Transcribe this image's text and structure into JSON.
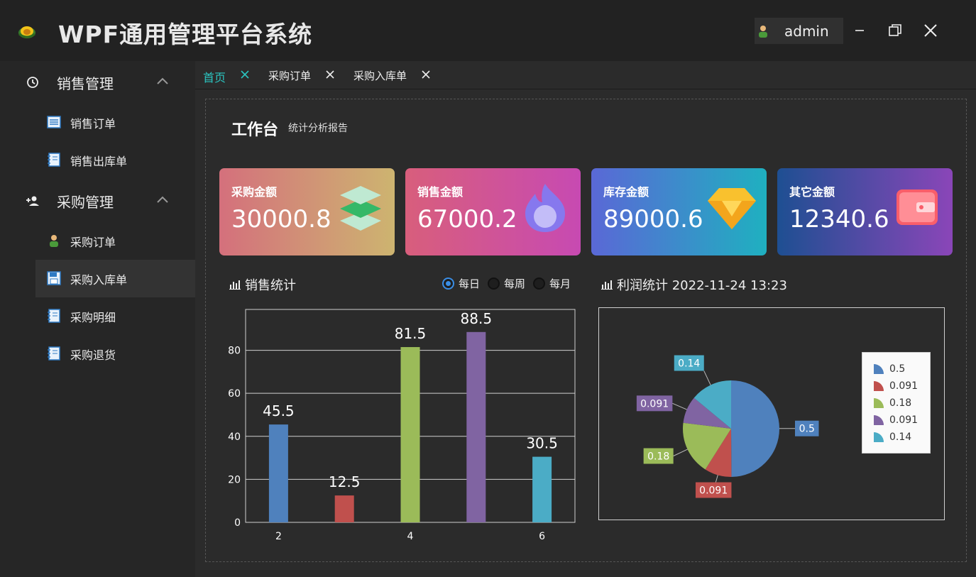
{
  "app": {
    "title": "WPF通用管理平台系统",
    "user": "admin"
  },
  "sidebar": {
    "groups": [
      {
        "label": "销售管理",
        "icon": "clock-icon",
        "items": [
          {
            "label": "销售订单",
            "icon": "list-icon"
          },
          {
            "label": "销售出库单",
            "icon": "notebook-icon"
          }
        ]
      },
      {
        "label": "采购管理",
        "icon": "person-add-icon",
        "items": [
          {
            "label": "采购订单",
            "icon": "user-icon"
          },
          {
            "label": "采购入库单",
            "icon": "save-icon",
            "active": true
          },
          {
            "label": "采购明细",
            "icon": "notebook-icon"
          },
          {
            "label": "采购退货",
            "icon": "notebook-icon"
          }
        ]
      }
    ]
  },
  "tabs": [
    {
      "label": "首页",
      "active": true
    },
    {
      "label": "采购订单"
    },
    {
      "label": "采购入库单"
    }
  ],
  "dashboard": {
    "title": "工作台",
    "subtitle": "统计分析报告",
    "cards": [
      {
        "label": "采购金额",
        "value": "30000.8",
        "icon": "layers-icon"
      },
      {
        "label": "销售金额",
        "value": "67000.2",
        "icon": "flame-icon"
      },
      {
        "label": "库存金额",
        "value": "89000.6",
        "icon": "diamond-icon"
      },
      {
        "label": "其它金额",
        "value": "12340.6",
        "icon": "wallet-icon"
      }
    ],
    "sales_title": "销售统计",
    "period_options": [
      "每日",
      "每周",
      "每月"
    ],
    "period_selected": "每日",
    "profit_title": "利润统计 2022-11-24 13:23"
  },
  "colors": {
    "accent": "#2bc4c0",
    "blue": "#4f81bd",
    "red": "#c0504d",
    "green": "#9bbb59",
    "purple": "#8064a2",
    "teal": "#4bacc6"
  },
  "chart_data": [
    {
      "type": "bar",
      "x": [
        2,
        3,
        4,
        5,
        6
      ],
      "values": [
        45.5,
        12.5,
        81.5,
        88.5,
        30.5
      ],
      "data_labels": [
        "45.5",
        "12.5",
        "81.5",
        "88.5",
        "30.5"
      ],
      "xticks": [
        2,
        4,
        6
      ],
      "yticks": [
        0,
        20,
        40,
        60,
        80
      ],
      "ylim": [
        0,
        99
      ],
      "xlim": [
        1.5,
        6.5
      ],
      "grid": true,
      "colors": [
        "#4f81bd",
        "#c0504d",
        "#9bbb59",
        "#8064a2",
        "#4bacc6"
      ]
    },
    {
      "type": "pie",
      "values": [
        0.5,
        0.091,
        0.18,
        0.091,
        0.14
      ],
      "labels": [
        "0.5",
        "0.091",
        "0.18",
        "0.091",
        "0.14"
      ],
      "legend": [
        "0.5",
        "0.091",
        "0.18",
        "0.091",
        "0.14"
      ],
      "legend_placement": "right",
      "colors": [
        "#4f81bd",
        "#c0504d",
        "#9bbb59",
        "#8064a2",
        "#4bacc6"
      ]
    }
  ]
}
